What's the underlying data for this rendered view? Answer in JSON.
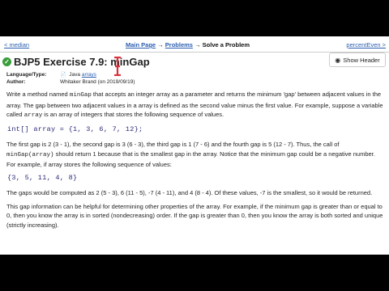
{
  "nav": {
    "prev": "< median",
    "next": "percentEven >",
    "crumb_main": "Main Page",
    "arrow1": "→",
    "crumb_problems": "Problems",
    "arrow2": "→",
    "crumb_current": "Solve a Problem"
  },
  "header": {
    "title": "BJP5 Exercise 7.9: minGap",
    "show_header_label": "Show Header"
  },
  "meta": {
    "lang_label": "Language/Type:",
    "lang_value": "Java",
    "lang_topic": "arrays",
    "author_label": "Author:",
    "author_value": "Whitaker Brand (on 2019/09/19)"
  },
  "body": {
    "p1a": "Write a method named ",
    "p1_code1": "minGap",
    "p1b": " that accepts an integer array as a parameter and returns the minimum 'gap' between adjacent values in the array. The gap between two adjacent values in a array is defined as the second value minus the first value. For example, suppose a variable called ",
    "p1_code2": "array",
    "p1c": " is an array of integers that stores the following sequence of values.",
    "code1": "int[] array = {1, 3, 6, 7, 12};",
    "p2a": "The first gap is 2 (3 - 1), the second gap is 3 (6 - 3), the third gap is 1 (7 - 6) and the fourth gap is 5 (12 - 7). Thus, the call of ",
    "p2_code": "minGap(array)",
    "p2b": " should return 1 because that is the smallest gap in the array. Notice that the minimum gap could be a negative number. For example, if array stores the following sequence of values:",
    "code2": "{3, 5, 11, 4, 8}",
    "p3": "The gaps would be computed as 2 (5 - 3), 6 (11 - 5), -7 (4 - 11), and 4 (8 - 4). Of these values, -7 is the smallest, so it would be returned.",
    "p4": "This gap information can be helpful for determining other properties of the array. For example, if the minimum gap is greater than or equal to 0, then you know the array is in sorted (nondecreasing) order. If the gap is greater than 0, then you know the array is both sorted and unique (strictly increasing)."
  },
  "colors": {
    "link": "#2a5db0",
    "success": "#3a9d3a",
    "cursor": "#d8323c"
  }
}
